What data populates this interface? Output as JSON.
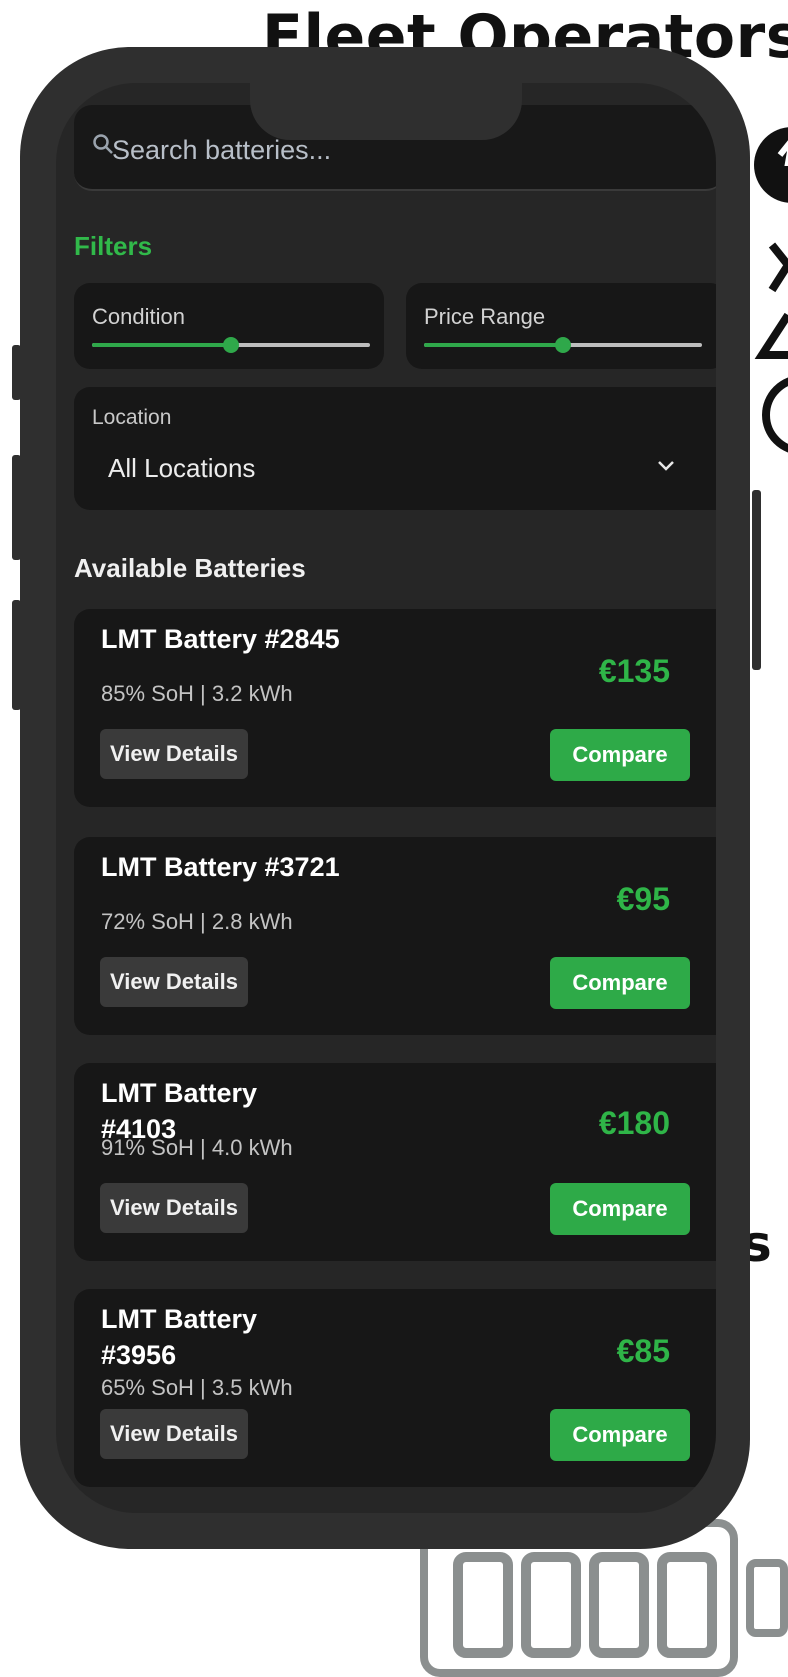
{
  "background": {
    "heading": "Fleet Operators",
    "partial_letter": "s",
    "battery_icon": "battery-icon"
  },
  "search": {
    "placeholder": "Search batteries...",
    "icon": "search-icon"
  },
  "filters": {
    "heading": "Filters",
    "condition": {
      "label": "Condition",
      "level_fraction": 0.5
    },
    "price_range": {
      "label": "Price Range",
      "level_fraction": 0.5
    },
    "location": {
      "label": "Location",
      "value": "All Locations",
      "icon": "chevron-down-icon"
    }
  },
  "listing": {
    "heading": "Available Batteries",
    "batteries": [
      {
        "name": "LMT Battery #2845",
        "spec": "85% SoH | 3.2 kWh",
        "price": "€135",
        "details_label": "View Details",
        "compare_label": "Compare"
      },
      {
        "name": "LMT Battery #3721",
        "spec": "72% SoH | 2.8 kWh",
        "price": "€95",
        "details_label": "View Details",
        "compare_label": "Compare"
      },
      {
        "name": "LMT Battery #4103",
        "spec": "91% SoH | 4.0 kWh",
        "price": "€180",
        "details_label": "View Details",
        "compare_label": "Compare"
      },
      {
        "name": "LMT Battery #3956",
        "spec": "65% SoH | 3.5 kWh",
        "price": "€85",
        "details_label": "View Details",
        "compare_label": "Compare"
      }
    ]
  },
  "colors": {
    "accent": "#2eaa48",
    "card": "#171717",
    "screen": "#262626",
    "frame": "#2f2f2f"
  }
}
